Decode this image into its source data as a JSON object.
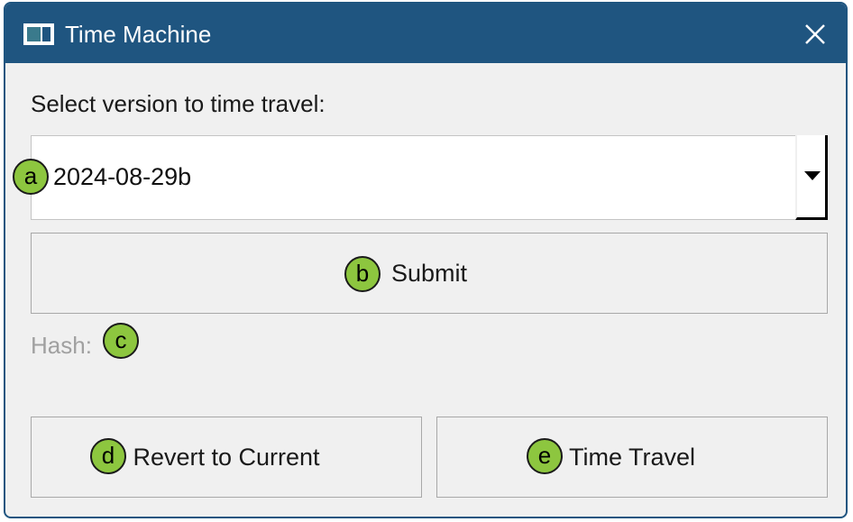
{
  "window": {
    "title": "Time Machine",
    "close_icon": "close-icon"
  },
  "prompt_label": "Select version to time travel:",
  "version_select": {
    "value": "2024-08-29b"
  },
  "buttons": {
    "submit": "Submit",
    "revert": "Revert to Current",
    "time_travel": "Time Travel"
  },
  "hash": {
    "label": "Hash:"
  },
  "markers": {
    "a": "a",
    "b": "b",
    "c": "c",
    "d": "d",
    "e": "e"
  },
  "colors": {
    "titlebar": "#1f5580",
    "marker": "#8dc63f"
  }
}
